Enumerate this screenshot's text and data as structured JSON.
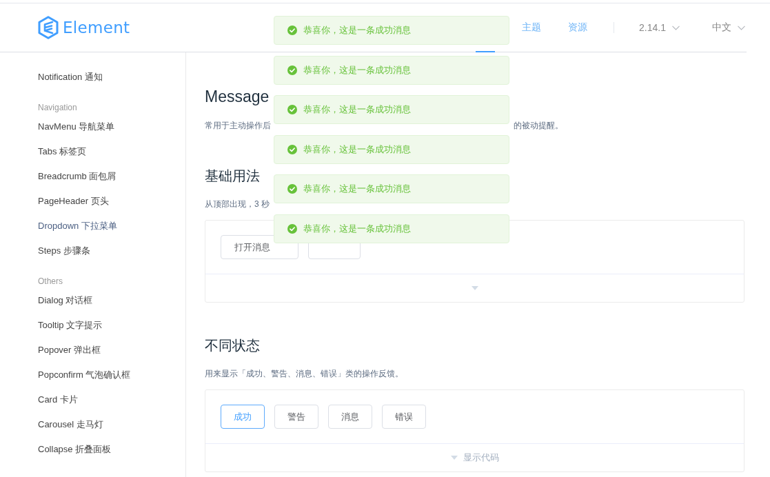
{
  "header": {
    "logo_text": "Element",
    "nav": [
      {
        "kind": "covered",
        "selected": true
      },
      {
        "kind": "link",
        "label": "主题",
        "selected": false
      },
      {
        "kind": "link",
        "label": "资源",
        "selected": false
      }
    ],
    "version": "2.14.1",
    "language": "中文"
  },
  "sidebar": {
    "groups": [
      {
        "items": [
          {
            "label": "Notification 通知",
            "hovered": false
          }
        ]
      },
      {
        "title": "Navigation",
        "items": [
          {
            "label": "NavMenu 导航菜单",
            "hovered": false
          },
          {
            "label": "Tabs 标签页",
            "hovered": false
          },
          {
            "label": "Breadcrumb 面包屑",
            "hovered": false
          },
          {
            "label": "PageHeader 页头",
            "hovered": false
          },
          {
            "label": "Dropdown 下拉菜单",
            "hovered": true
          },
          {
            "label": "Steps 步骤条",
            "hovered": false
          }
        ]
      },
      {
        "title": "Others",
        "items": [
          {
            "label": "Dialog 对话框",
            "hovered": false
          },
          {
            "label": "Tooltip 文字提示",
            "hovered": false
          },
          {
            "label": "Popover 弹出框",
            "hovered": false
          },
          {
            "label": "Popconfirm 气泡确认框",
            "hovered": false
          },
          {
            "label": "Card 卡片",
            "hovered": false
          },
          {
            "label": "Carousel 走马灯",
            "hovered": false
          },
          {
            "label": "Collapse 折叠面板",
            "hovered": false
          }
        ]
      }
    ]
  },
  "content": {
    "title": "Message",
    "description_parts": [
      "常用于主动操作后",
      "的被动提醒。"
    ],
    "sections": [
      {
        "heading": "基础用法",
        "text": "从顶部出现，3 秒",
        "demo": {
          "buttons": [
            {
              "kind": "partial",
              "label": "打开消息",
              "focused": false
            },
            {
              "kind": "blank",
              "focused": false
            }
          ],
          "footer": {
            "kind": "caret"
          }
        }
      },
      {
        "heading": "不同状态",
        "text": "用来显示「成功、警告、消息、错误」类的操作反馈。",
        "demo": {
          "buttons": [
            {
              "kind": "text",
              "label": "成功",
              "focused": true
            },
            {
              "kind": "text",
              "label": "警告",
              "focused": false
            },
            {
              "kind": "text",
              "label": "消息",
              "focused": false
            },
            {
              "kind": "text",
              "label": "错误",
              "focused": false
            }
          ],
          "footer": {
            "kind": "caret-label",
            "label": "显示代码"
          }
        }
      }
    ]
  },
  "messages": [
    {
      "kind": "success",
      "text": "恭喜你，这是一条成功消息"
    },
    {
      "kind": "success",
      "text": "恭喜你，这是一条成功消息"
    },
    {
      "kind": "success",
      "text": "恭喜你，这是一条成功消息"
    },
    {
      "kind": "success",
      "text": "恭喜你，这是一条成功消息"
    },
    {
      "kind": "success",
      "text": "恭喜你，这是一条成功消息"
    },
    {
      "kind": "success",
      "text": "恭喜你，这是一条成功消息"
    }
  ]
}
